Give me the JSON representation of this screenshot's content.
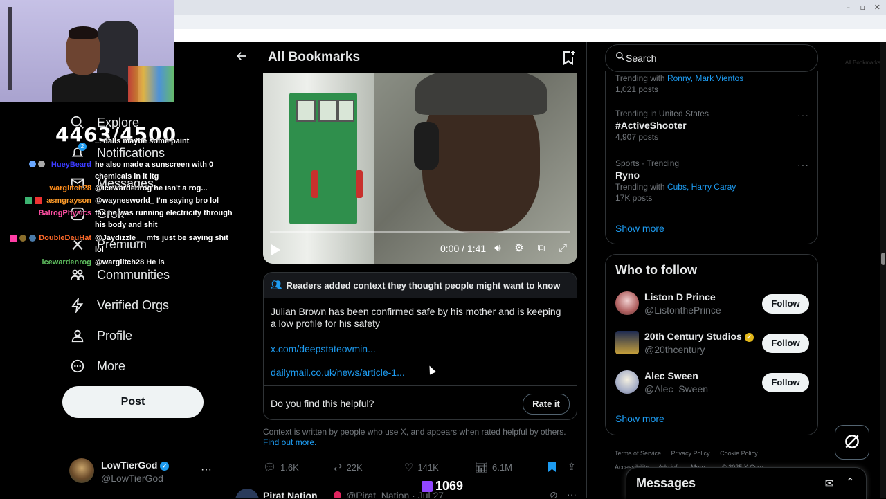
{
  "browser": {
    "bookmarks_folder": "All Bookmarks"
  },
  "overlay": {
    "counter": "4463/4500",
    "chat": [
      {
        "user": "",
        "message": "... dalls maybe some paint",
        "user_color": "#ffffff"
      },
      {
        "user": "HueyBeard",
        "message": "he also made a sunscreen with 0 chemicals in it ltg",
        "user_color": "#3b3bff"
      },
      {
        "user": "warglitch28",
        "message": "@icewardenrog he isn't a rog...",
        "user_color": "#ff8c1a"
      },
      {
        "user": "asmgrayson",
        "message": "@waynesworld_ I'm saying bro lol",
        "user_color": "#ff9d2b"
      },
      {
        "user": "BalrogPhysics",
        "message": "fax he was running electricity through his body and shit",
        "user_color": "#ff4fa3"
      },
      {
        "user": "DoubleDeuHat",
        "message": "@Jaydizzle__ mfs just be saying shit lol",
        "user_color": "#ff6a2a"
      },
      {
        "user": "icewardenrog",
        "message": "@warglitch28 He is",
        "user_color": "#5fbf5f"
      }
    ],
    "notification_count": "2",
    "twitch_viewers": "1069"
  },
  "nav": {
    "items": [
      {
        "label": "Explore",
        "icon": "search-icon"
      },
      {
        "label": "Notifications",
        "icon": "bell-icon"
      },
      {
        "label": "Messages",
        "icon": "mail-icon"
      },
      {
        "label": "Grok",
        "icon": "grok-icon"
      },
      {
        "label": "Premium",
        "icon": "x-logo-icon"
      },
      {
        "label": "Communities",
        "icon": "people-icon"
      },
      {
        "label": "Verified Orgs",
        "icon": "bolt-icon"
      },
      {
        "label": "Profile",
        "icon": "person-icon"
      },
      {
        "label": "More",
        "icon": "more-circle-icon"
      }
    ],
    "post_label": "Post",
    "account": {
      "name": "LowTierGod",
      "handle": "@LowTierGod"
    }
  },
  "main": {
    "title": "All Bookmarks",
    "video": {
      "time": "0:00 / 1:41"
    },
    "community_note": {
      "header": "Readers added context they thought people might want to know",
      "text": "Julian Brown has been confirmed safe by his mother and is keeping a low profile for his safety",
      "links": [
        "x.com/deepstateovmin...",
        "dailymail.co.uk/news/article-1..."
      ],
      "question": "Do you find this helpful?",
      "rate_label": "Rate it",
      "footer_text": "Context is written by people who use X, and appears when rated helpful by others.",
      "footer_link": "Find out more."
    },
    "actions": {
      "replies": "1.6K",
      "reposts": "22K",
      "likes": "141K",
      "views": "6.1M"
    },
    "next_post": {
      "name": "Pirat Nation",
      "handle_date": "@Pirat_Nation · Jul 27"
    }
  },
  "right": {
    "search_placeholder": "Search",
    "trends": [
      {
        "meta": "",
        "name": "",
        "with_label": "Trending with",
        "with": "Ronny, Mark Vientos",
        "count": "1,021 posts"
      },
      {
        "meta": "Trending in United States",
        "name": "#ActiveShooter",
        "with_label": "",
        "with": "",
        "count": "4,907 posts"
      },
      {
        "meta": "Sports · Trending",
        "name": "Ryno",
        "with_label": "Trending with",
        "with": "Cubs, Harry Caray",
        "count": "17K posts"
      }
    ],
    "show_more": "Show more",
    "who_to_follow": {
      "title": "Who to follow",
      "accounts": [
        {
          "name": "Liston D Prince",
          "handle": "@ListonthePrince",
          "button": "Follow",
          "verified": ""
        },
        {
          "name": "20th Century Studios",
          "handle": "@20thcentury",
          "button": "Follow",
          "verified": "gold"
        },
        {
          "name": "Alec Sween",
          "handle": "@Alec_Sween",
          "button": "Follow",
          "verified": ""
        }
      ],
      "show_more": "Show more"
    },
    "footer_links": [
      "Terms of Service",
      "Privacy Policy",
      "Cookie Policy",
      "Accessibility",
      "Ads info",
      "More ...",
      "© 2025 X Corp."
    ],
    "messages_title": "Messages"
  }
}
